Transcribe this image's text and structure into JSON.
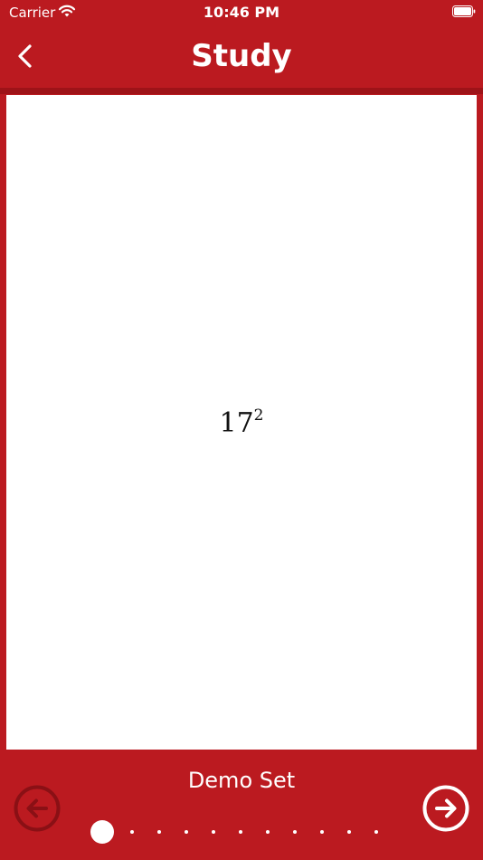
{
  "status_bar": {
    "carrier": "Carrier",
    "time": "10:46 PM",
    "wifi_icon": "wifi-icon",
    "battery_icon": "battery-icon"
  },
  "nav": {
    "title": "Study",
    "back_icon": "chevron-left-icon"
  },
  "card": {
    "base": "17",
    "exponent": "2"
  },
  "footer": {
    "set_name": "Demo Set",
    "prev_icon": "arrow-left-circle-icon",
    "next_icon": "arrow-right-circle-icon",
    "page_count": 11,
    "current_page": 1
  },
  "colors": {
    "brand_red": "#bb1a20",
    "dark_red": "#8a1015",
    "white": "#ffffff"
  }
}
